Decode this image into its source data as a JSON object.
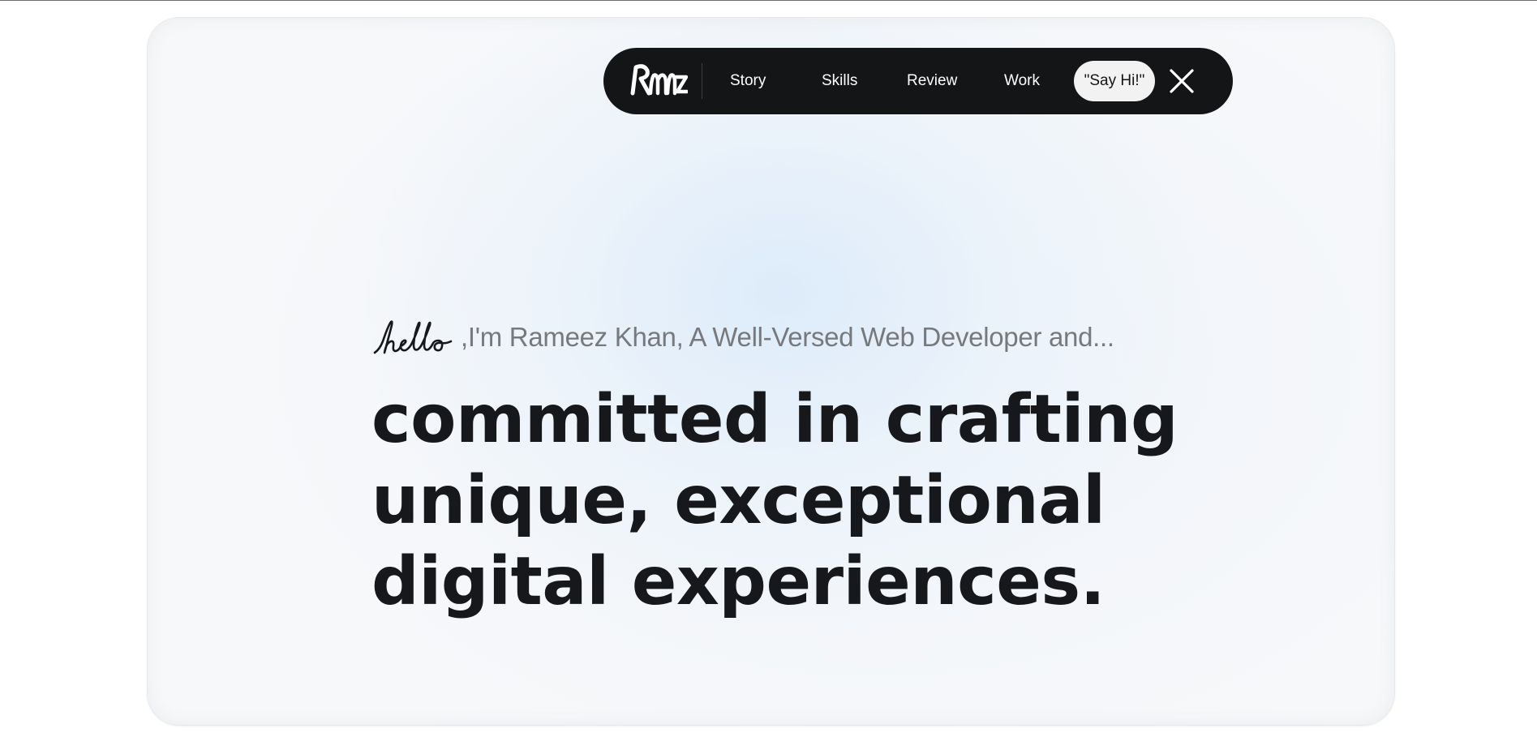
{
  "nav": {
    "logo_alt": "Rmz",
    "items": [
      {
        "label": "Story"
      },
      {
        "label": "Skills"
      },
      {
        "label": "Review"
      },
      {
        "label": "Work"
      }
    ],
    "cta_label": "\"Say Hi!\"",
    "close_icon": "close-icon"
  },
  "hero": {
    "greeting_script": "hello",
    "intro": ",I'm Rameez Khan, A Well-Versed Web Developer and...",
    "headline_lines": [
      "committed in crafting",
      "unique, exceptional",
      "digital experiences."
    ]
  },
  "colors": {
    "nav_bg": "#141517",
    "cta_bg": "#f2f2f2",
    "headline": "#17181b",
    "intro": "#77797d"
  }
}
